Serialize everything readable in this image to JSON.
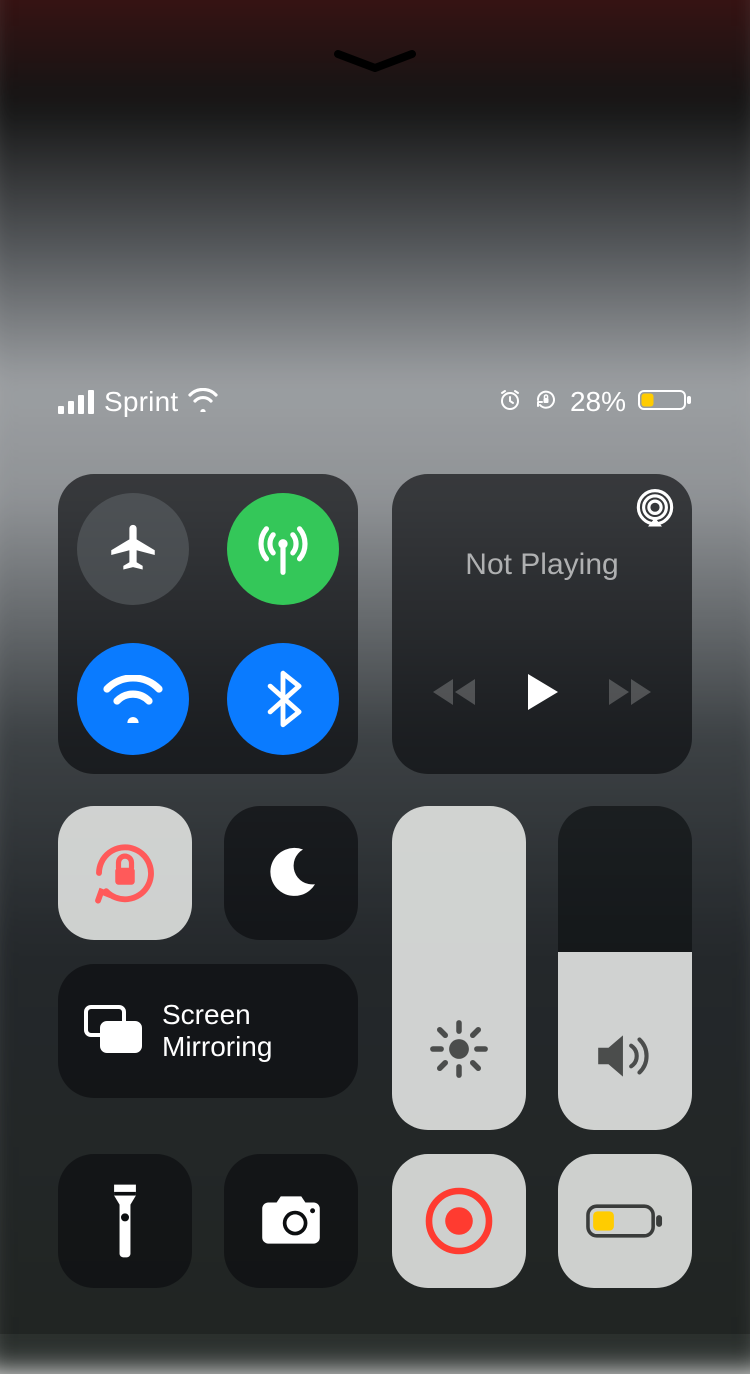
{
  "status": {
    "carrier": "Sprint",
    "battery_pct": "28%",
    "battery_level": 0.28,
    "battery_color": "#ffcc00",
    "alarm_on": true,
    "orientation_lock_on": true,
    "wifi_on": true
  },
  "connectivity": {
    "airplane_on": false,
    "cellular_on": true,
    "wifi_on": true,
    "bluetooth_on": true
  },
  "media": {
    "title": "Not Playing",
    "playing": false
  },
  "orientation_lock_on": true,
  "dnd_on": false,
  "screen_mirroring_label": "Screen\nMirroring",
  "brightness_level": 1.0,
  "volume_level": 0.55,
  "colors": {
    "active_green": "#34c759",
    "active_blue": "#0a7bff",
    "record_red": "#ff3b30",
    "lowpow_yellow": "#ffcc00"
  }
}
